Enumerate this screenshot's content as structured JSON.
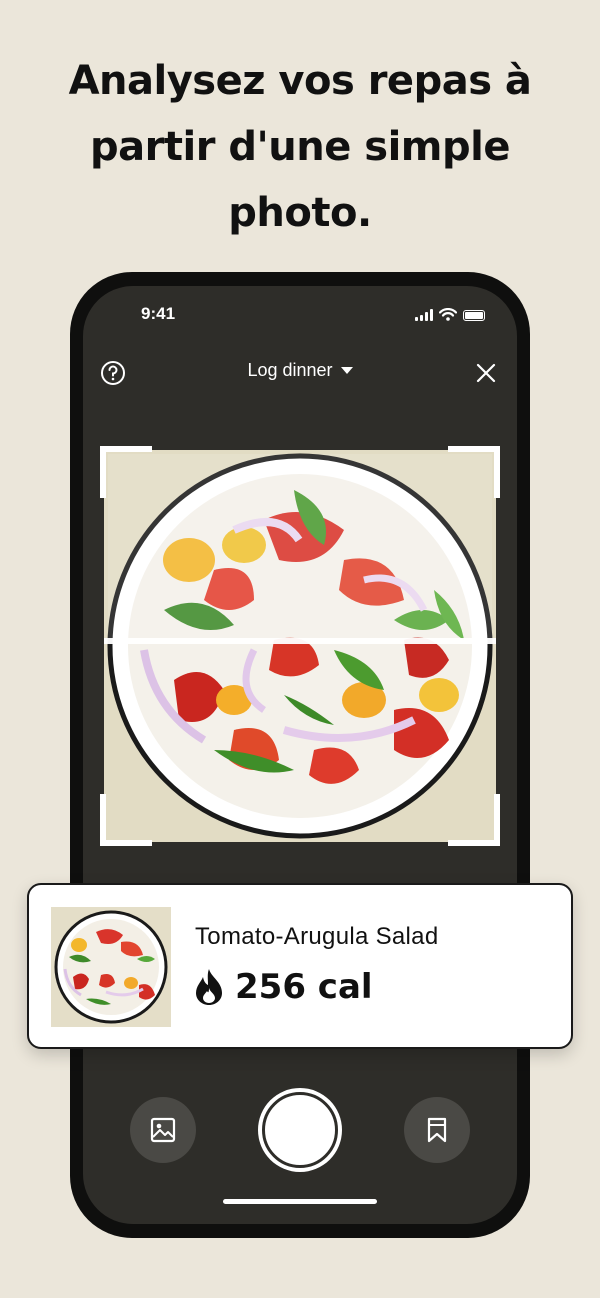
{
  "headline": "Analysez vos repas à partir d'une simple photo.",
  "status_bar": {
    "time": "9:41",
    "icons": [
      "signal-icon",
      "wifi-icon",
      "battery-icon"
    ]
  },
  "top_bar": {
    "help_icon": "question-circle-icon",
    "meal_selector_label": "Log dinner",
    "dropdown_icon": "caret-down-icon",
    "close_icon": "close-icon"
  },
  "result": {
    "food_name": "Tomato-Arugula Salad",
    "calorie_icon": "flame-icon",
    "calories": "256 cal"
  },
  "controls": {
    "gallery_icon": "image-icon",
    "shutter": "shutter-button",
    "saved_icon": "bookmark-icon"
  },
  "colors": {
    "background": "#ebe6da",
    "phone_screen": "#2e2d29",
    "card": "#ffffff",
    "text": "#111111"
  }
}
